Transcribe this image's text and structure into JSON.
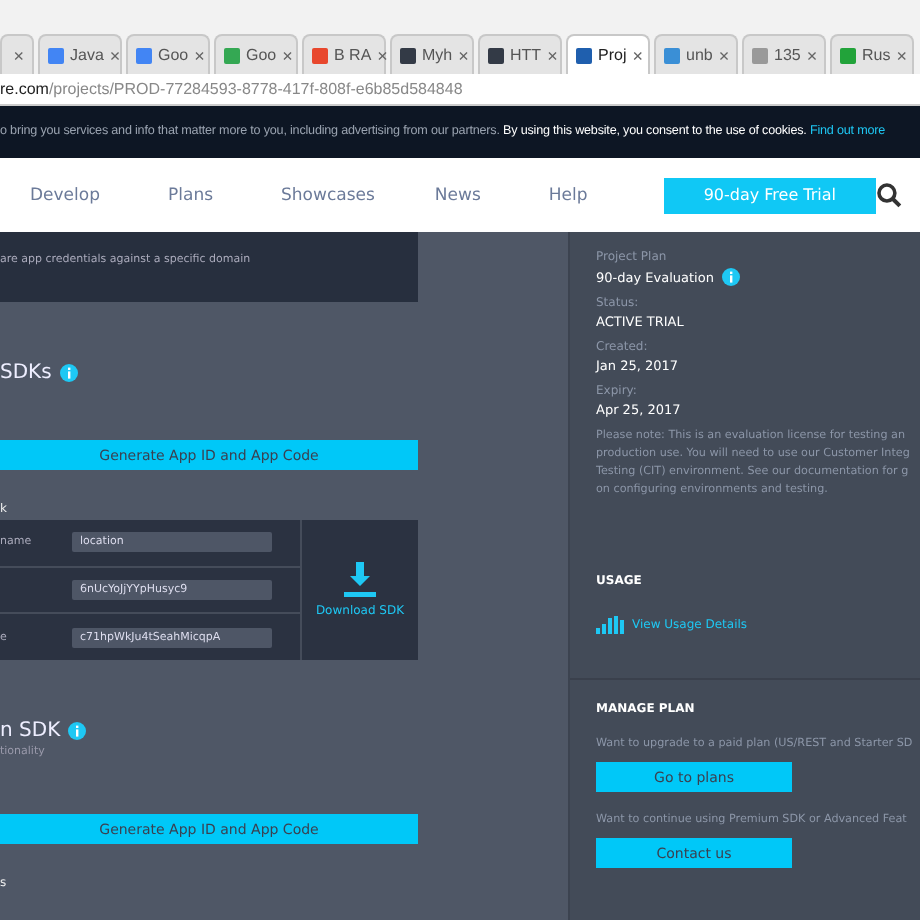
{
  "browser": {
    "tabs": [
      {
        "kind": "plain",
        "selected": false
      },
      {
        "title": "Java",
        "kind": "google",
        "selected": false
      },
      {
        "title": "Goo",
        "kind": "google",
        "selected": false
      },
      {
        "title": "Goo",
        "kind": "dots",
        "selected": false
      },
      {
        "title": "B RA",
        "kind": "red",
        "selected": false
      },
      {
        "title": "Myh",
        "kind": "dark",
        "selected": false
      },
      {
        "title": "HTT",
        "kind": "dark",
        "selected": false
      },
      {
        "title": "Proj",
        "kind": "blue",
        "selected": true
      },
      {
        "title": "unb",
        "kind": "bars",
        "selected": false
      },
      {
        "title": "135",
        "kind": "page",
        "selected": false
      },
      {
        "title": "Rus",
        "kind": "green",
        "selected": false
      }
    ],
    "close_glyph": "×",
    "url_host": "re.com",
    "url_path": "/projects/PROD-77284593-8778-417f-808f-e6b85d584848"
  },
  "cookie_bar": {
    "text": "o bring you services and info that matter more to you, including advertising from our partners.",
    "consent": "By using this website, you consent to the use of cookies.",
    "link": "Find out more"
  },
  "nav": {
    "items": [
      "Develop",
      "Plans",
      "Showcases",
      "News",
      "Help"
    ],
    "trial_button": "90-day Free Trial"
  },
  "main": {
    "domain_note": "are app credentials against a specific domain",
    "sections": [
      {
        "title": "SDKs",
        "button": "Generate App ID and App Code",
        "footer": "k",
        "credentials": [
          {
            "label": "name",
            "value": "location"
          },
          {
            "value": "6nUcYoJjYYpHusyc9"
          },
          {
            "label": "e",
            "value": "c71hpWkJu4tSeahMicqpA"
          }
        ],
        "download": "Download SDK"
      },
      {
        "title": "n SDK",
        "subtitle": "tionality",
        "button": "Generate App ID and App Code",
        "footer": "s"
      }
    ]
  },
  "side": {
    "fields": [
      {
        "label": "Project Plan",
        "value": "90-day Evaluation",
        "info": true
      },
      {
        "label": "Status:",
        "value": "ACTIVE TRIAL",
        "info": false
      },
      {
        "label": "Created:",
        "value": "Jan 25, 2017",
        "info": false
      },
      {
        "label": "Expiry:",
        "value": "Apr 25, 2017",
        "info": false
      }
    ],
    "note_lines": [
      "Please note: This is an evaluation license for testing an",
      "production use. You will need to use our Customer Integ",
      "Testing (CIT) environment. See our documentation for g",
      "on configuring environments and testing."
    ],
    "usage_title": "USAGE",
    "usage_link": "View Usage Details",
    "manage_title": "MANAGE PLAN",
    "upgrade_text": "Want to upgrade to a paid plan (US/REST and Starter SD",
    "plans_button": "Go to plans",
    "premium_text": "Want to continue using Premium SDK or Advanced Feat",
    "contact_button": "Contact us"
  }
}
